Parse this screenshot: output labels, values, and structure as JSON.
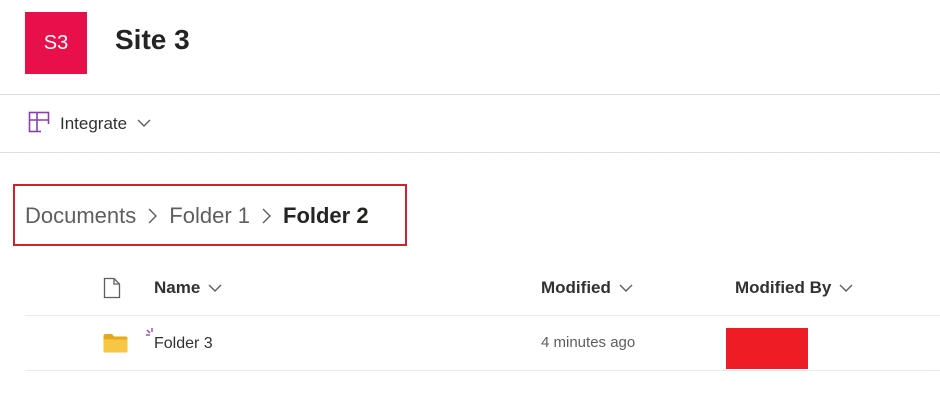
{
  "site": {
    "logo_text": "S3",
    "title": "Site 3"
  },
  "command_bar": {
    "integrate_label": "Integrate"
  },
  "breadcrumb": [
    "Documents",
    "Folder 1",
    "Folder 2"
  ],
  "columns": {
    "name": "Name",
    "modified": "Modified",
    "modified_by": "Modified By"
  },
  "rows": [
    {
      "name": "Folder 3",
      "modified": "4 minutes ago",
      "modified_by_redacted": true
    }
  ],
  "colors": {
    "logo": "#e8104a",
    "highlight_border": "#d4202a",
    "redaction": "#ee1c25",
    "folder": "#f7c644",
    "accent_purple": "#8a3fad"
  }
}
